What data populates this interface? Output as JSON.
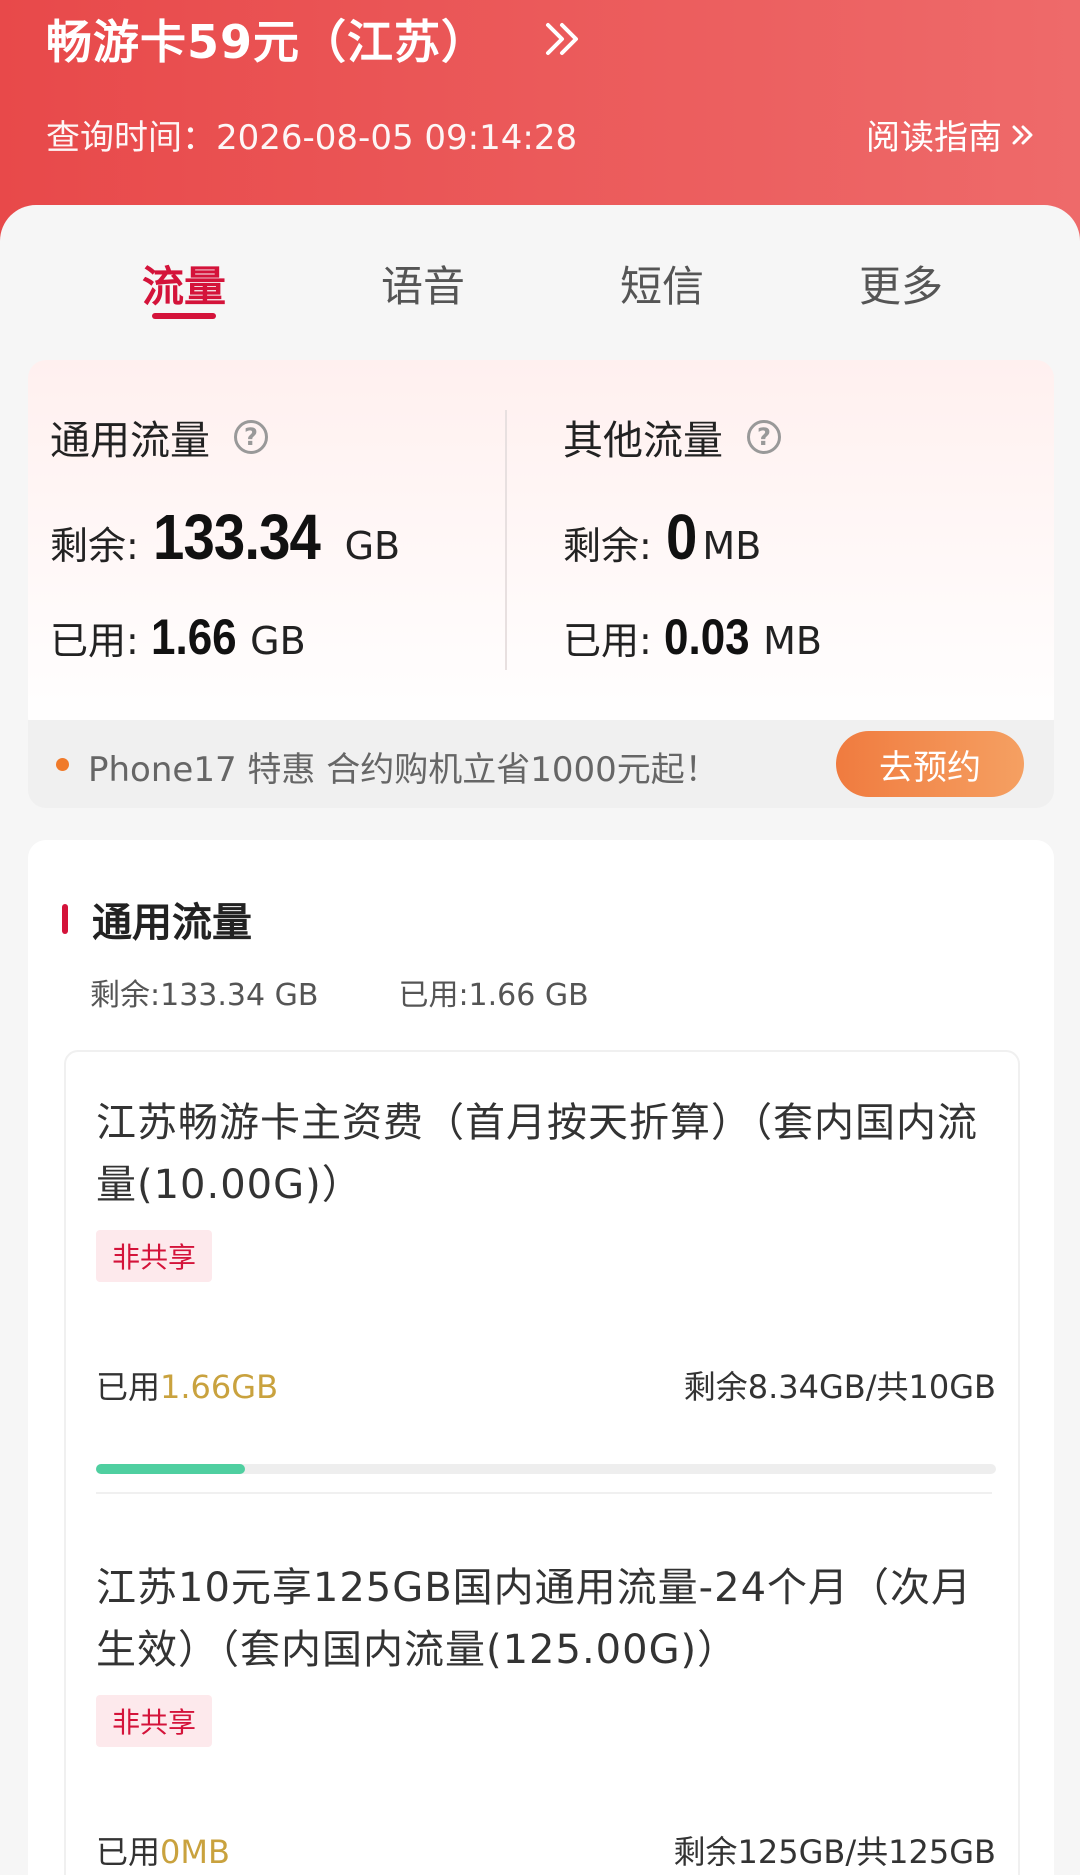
{
  "header": {
    "plan_title": "畅游卡59元（江苏）",
    "query_time": "查询时间：2026-08-05 09:14:28",
    "guide_label": "阅读指南"
  },
  "tabs": [
    {
      "label": "流量",
      "active": true
    },
    {
      "label": "语音",
      "active": false
    },
    {
      "label": "短信",
      "active": false
    },
    {
      "label": "更多",
      "active": false
    }
  ],
  "summary": {
    "general": {
      "title": "通用流量",
      "remain_label": "剩余:",
      "remain_value": "133.34",
      "remain_unit": "GB",
      "used_label": "已用:",
      "used_value": "1.66",
      "used_unit": "GB"
    },
    "other": {
      "title": "其他流量",
      "remain_label": "剩余:",
      "remain_value": "0",
      "remain_unit": "MB",
      "used_label": "已用:",
      "used_value": "0.03",
      "used_unit": "MB"
    }
  },
  "promo": {
    "text": "Phone17 特惠 合约购机立省1000元起！",
    "button": "去预约"
  },
  "detail": {
    "title": "通用流量",
    "remain_text": "剩余:133.34 GB",
    "used_text": "已用:1.66 GB",
    "packages": [
      {
        "name": "江苏畅游卡主资费（首月按天折算）（套内国内流量(10.00G)）",
        "tag": "非共享",
        "used_label": "已用",
        "used_value": "1.66GB",
        "remain_text": "剩余8.34GB/共10GB",
        "used_fraction": 0.166
      },
      {
        "name": "江苏10元享125GB国内通用流量-24个月（次月生效）（套内国内流量(125.00G)）",
        "tag": "非共享",
        "used_label": "已用",
        "used_value": "0MB",
        "remain_text": "剩余125GB/共125GB",
        "used_fraction": 0
      }
    ]
  },
  "colors": {
    "header_red": "#e8494a",
    "accent_red": "#d4133a",
    "used_gold": "#c9a23e",
    "progress_green": "#4fcfa0",
    "promo_orange": "#f07b3f"
  },
  "icons": {
    "plan_chevron": "double-chevron-right-icon",
    "guide_chevron": "double-chevron-right-icon",
    "help": "question-circle-icon"
  }
}
